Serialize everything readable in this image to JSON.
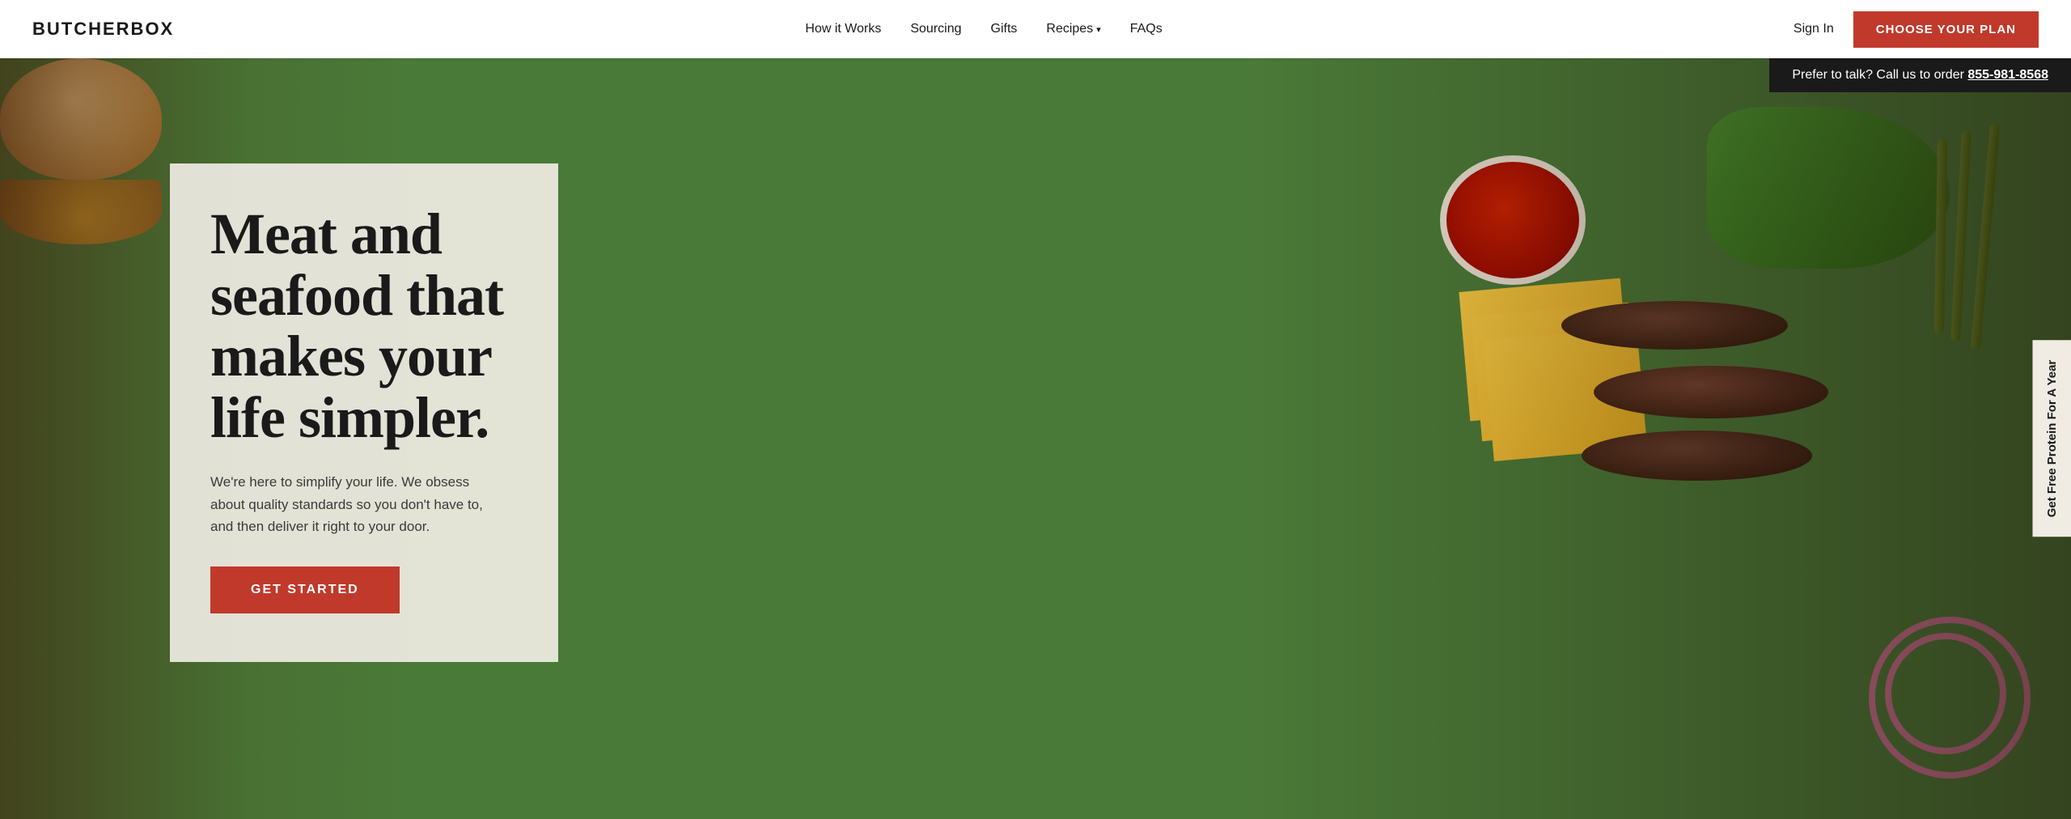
{
  "logo": {
    "text": "BUTCHERBOX"
  },
  "navbar": {
    "links": [
      {
        "id": "how-it-works",
        "label": "How it Works",
        "hasDropdown": false
      },
      {
        "id": "sourcing",
        "label": "Sourcing",
        "hasDropdown": false
      },
      {
        "id": "gifts",
        "label": "Gifts",
        "hasDropdown": false
      },
      {
        "id": "recipes",
        "label": "Recipes",
        "hasDropdown": true
      },
      {
        "id": "faqs",
        "label": "FAQs",
        "hasDropdown": false
      }
    ],
    "signIn": "Sign In",
    "cta": "CHOOSE YOUR PLAN"
  },
  "phoneBanner": {
    "text": "Prefer to talk? Call us to order ",
    "phone": "855-981-8568"
  },
  "hero": {
    "headline": "Meat and seafood that makes your life simpler.",
    "subtext": "We're here to simplify your life. We obsess about quality standards so you don't have to, and then deliver it right to your door.",
    "ctaLabel": "GET STARTED"
  },
  "sideTab": {
    "label": "Get Free Protein For A Year"
  }
}
